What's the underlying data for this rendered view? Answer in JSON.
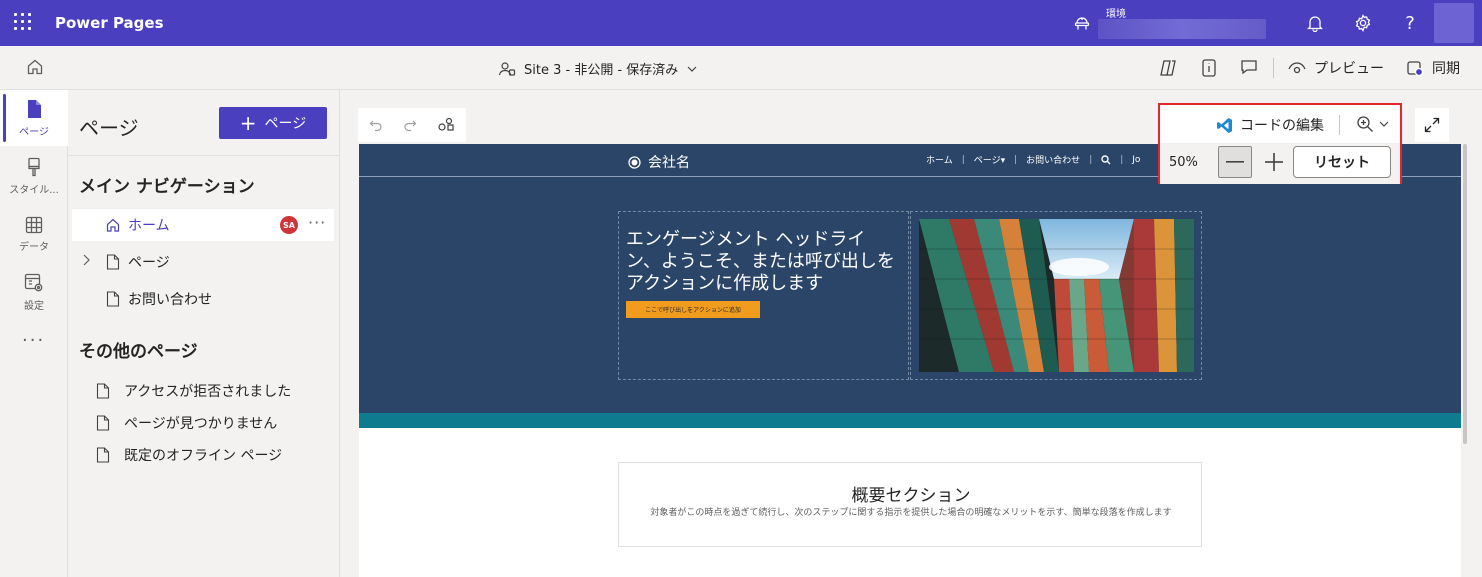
{
  "topbar": {
    "app_title": "Power Pages",
    "environment_label": "環境",
    "environment_value": ""
  },
  "cmdbar": {
    "site_title": "Site 3 - 非公開 - 保存済み",
    "preview_label": "プレビュー",
    "sync_label": "同期"
  },
  "rail": {
    "items": [
      {
        "label": "ページ"
      },
      {
        "label": "スタイル..."
      },
      {
        "label": "データ"
      },
      {
        "label": "設定"
      }
    ],
    "more": "···"
  },
  "panel": {
    "title": "ページ",
    "add_page_label": "ページ",
    "main_nav_heading": "メイン ナビゲーション",
    "main_nav_items": [
      {
        "label": "ホーム",
        "badge": "SA",
        "more": "···"
      },
      {
        "label": "ページ"
      },
      {
        "label": "お問い合わせ"
      }
    ],
    "other_heading": "その他のページ",
    "other_items": [
      {
        "label": "アクセスが拒否されました"
      },
      {
        "label": "ページが見つかりません"
      },
      {
        "label": "既定のオフライン ページ"
      }
    ]
  },
  "zoom": {
    "code_edit_label": "コードの編集",
    "percent": "50%",
    "reset_label": "リセット"
  },
  "preview": {
    "brand": "会社名",
    "nav_links": [
      "ホーム",
      "ページ▾",
      "お問い合わせ",
      "Jo"
    ],
    "headline": "エンゲージメント ヘッドライン、ようこそ、または呼び出しをアクションに作成します",
    "cta": "ここで呼び出しをアクションに追加",
    "about_title": "概要セクション",
    "about_body": "対象者がこの時点を過ぎて続行し、次のステップに関する指示を提供した場合の明確なメリットを示す、簡単な段落を作成します"
  },
  "colors": {
    "brand": "#4a3fbf",
    "preview_nav": "#2b4568",
    "teal_band": "#0f7b8f",
    "cta": "#f29c1d",
    "highlight": "#e0282e"
  }
}
